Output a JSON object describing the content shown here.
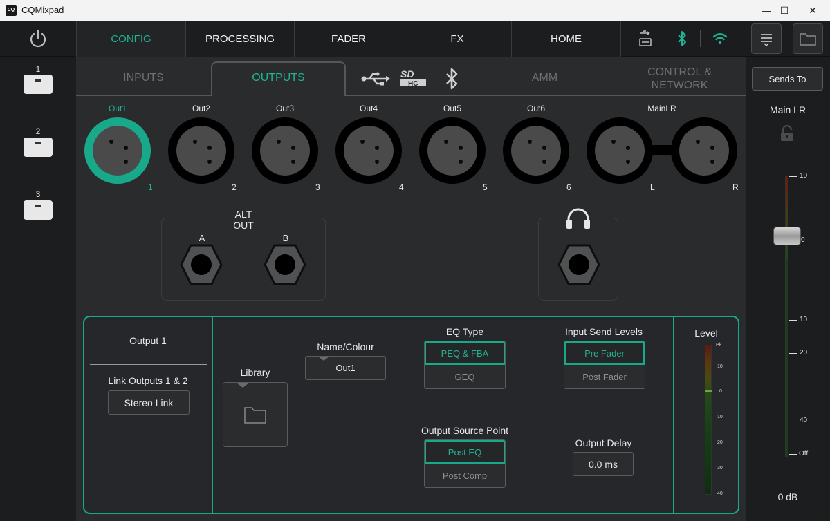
{
  "window": {
    "logo_text": "CQ",
    "title": "CQMixpad",
    "minimize_glyph": "—",
    "maximize_glyph": "☐",
    "close_glyph": "✕"
  },
  "topnav": {
    "tabs": [
      {
        "label": "CONFIG",
        "active": true
      },
      {
        "label": "PROCESSING",
        "active": false
      },
      {
        "label": "FADER",
        "active": false
      },
      {
        "label": "FX",
        "active": false
      },
      {
        "label": "HOME",
        "active": false
      }
    ],
    "status_icons": [
      "usb-sd-status-icon",
      "bluetooth-icon",
      "wifi-icon"
    ],
    "right_buttons": [
      "menu-icon",
      "folder-icon"
    ]
  },
  "sidebar": {
    "scenes": [
      "1",
      "2",
      "3"
    ]
  },
  "subtabs": {
    "inputs": "INPUTS",
    "outputs": "OUTPUTS",
    "amm": "AMM",
    "control_line1": "CONTROL &",
    "control_line2": "NETWORK",
    "icon_tabs": [
      "usb-icon",
      "sd-card-icon",
      "bluetooth-icon"
    ]
  },
  "outputs": {
    "channels": [
      {
        "label": "Out1",
        "num": "1",
        "active": true
      },
      {
        "label": "Out2",
        "num": "2",
        "active": false
      },
      {
        "label": "Out3",
        "num": "3",
        "active": false
      },
      {
        "label": "Out4",
        "num": "4",
        "active": false
      },
      {
        "label": "Out5",
        "num": "5",
        "active": false
      },
      {
        "label": "Out6",
        "num": "6",
        "active": false
      }
    ],
    "main": {
      "label": "MainLR",
      "left": "L",
      "right": "R"
    }
  },
  "alt_out": {
    "title_line1": "ALT",
    "title_line2": "OUT",
    "a": "A",
    "b": "B"
  },
  "panel": {
    "output_title": "Output 1",
    "link_label": "Link Outputs 1 & 2",
    "stereo_link": "Stereo Link",
    "library": "Library",
    "name_colour_label": "Name/Colour",
    "name_value": "Out1",
    "eq_type_label": "EQ Type",
    "eq_options": [
      {
        "label": "PEQ & FBA",
        "on": true
      },
      {
        "label": "GEQ",
        "on": false
      }
    ],
    "send_levels_label": "Input Send Levels",
    "send_options": [
      {
        "label": "Pre Fader",
        "on": true
      },
      {
        "label": "Post Fader",
        "on": false
      }
    ],
    "source_point_label": "Output Source Point",
    "source_options": [
      {
        "label": "Post EQ",
        "on": true
      },
      {
        "label": "Post Comp",
        "on": false
      }
    ],
    "delay_label": "Output Delay",
    "delay_value": "0.0 ms",
    "level_label": "Level",
    "level_scale": [
      "Pk",
      "10",
      "0",
      "10",
      "20",
      "30",
      "40"
    ]
  },
  "right": {
    "sends_to": "Sends To",
    "main_lr": "Main LR",
    "scale": [
      "10",
      "0",
      "10",
      "20",
      "40",
      "Off"
    ],
    "fader_value": "0 dB"
  },
  "colors": {
    "accent": "#17a98a",
    "accent_text": "#1fb394",
    "background": "#2a2b2c"
  }
}
